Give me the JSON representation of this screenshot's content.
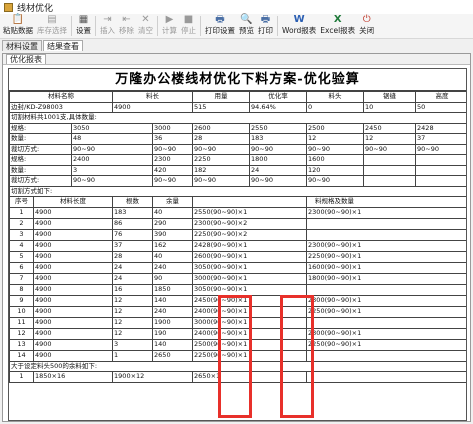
{
  "window": {
    "title": "线材优化"
  },
  "toolbar": [
    {
      "label": "粘贴数据",
      "icon": "paste-icon",
      "enabled": true
    },
    {
      "label": "库存选择",
      "icon": "stock-icon",
      "enabled": false
    },
    {
      "label": "设置",
      "icon": "settings-icon",
      "enabled": true
    },
    {
      "label": "插入",
      "icon": "insert-icon",
      "enabled": false
    },
    {
      "label": "移除",
      "icon": "remove-icon",
      "enabled": false
    },
    {
      "label": "清空",
      "icon": "clear-icon",
      "enabled": false
    },
    {
      "label": "计算",
      "icon": "play-icon",
      "enabled": false
    },
    {
      "label": "停止",
      "icon": "stop-icon",
      "enabled": false
    },
    {
      "label": "打印设置",
      "icon": "print-setup-icon",
      "enabled": true
    },
    {
      "label": "预览",
      "icon": "preview-icon",
      "enabled": true
    },
    {
      "label": "打印",
      "icon": "print-icon",
      "enabled": true
    },
    {
      "label": "Word报表",
      "icon": "word-icon",
      "enabled": true
    },
    {
      "label": "Excel报表",
      "icon": "excel-icon",
      "enabled": true
    },
    {
      "label": "关闭",
      "icon": "close-icon",
      "enabled": true
    }
  ],
  "tabs": [
    "材料设置",
    "结果查看"
  ],
  "subtabs": [
    "优化报表"
  ],
  "report": {
    "title": "万隆办公楼线材优化下料方案-优化验算",
    "material_header": [
      "材料名称",
      "料长",
      "用量",
      "优化率",
      "料头",
      "锯缝",
      "高度"
    ],
    "material_row": [
      "边封/KD-Z98003",
      "4900",
      "515",
      "94.64%",
      "0",
      "10",
      "50"
    ],
    "cut_total_line": "切割材料共1001支,具体数量:",
    "spec_blocks": [
      {
        "spec": [
          "规格:",
          "3050",
          "3000",
          "2600",
          "2550",
          "2500",
          "2450",
          "2428"
        ],
        "qty": [
          "数量:",
          "48",
          "36",
          "28",
          "183",
          "12",
          "12",
          "37"
        ],
        "cut": [
          "裁切方式:",
          "90~90",
          "90~90",
          "90~90",
          "90~90",
          "90~90",
          "90~90",
          "90~90"
        ]
      },
      {
        "spec": [
          "规格:",
          "2400",
          "2300",
          "2250",
          "1800",
          "1600",
          "",
          ""
        ],
        "qty": [
          "数量:",
          "3",
          "420",
          "182",
          "24",
          "120",
          "",
          ""
        ],
        "cut": [
          "裁切方式:",
          "90~90",
          "90~90",
          "90~90",
          "90~90",
          "90~90",
          "",
          ""
        ]
      }
    ],
    "cut_method_line": "切割方式如下:",
    "cut_header": [
      "序号",
      "材料长度",
      "根数",
      "余量",
      "",
      "",
      "料规格及数量"
    ],
    "cut_rows": [
      [
        "1",
        "4900",
        "183",
        "40",
        "2550(90~90)×1",
        "2300(90~90)×1"
      ],
      [
        "2",
        "4900",
        "86",
        "290",
        "2300(90~90)×2",
        ""
      ],
      [
        "3",
        "4900",
        "76",
        "390",
        "2250(90~90)×2",
        ""
      ],
      [
        "4",
        "4900",
        "37",
        "162",
        "2428(90~90)×1",
        "2300(90~90)×1"
      ],
      [
        "5",
        "4900",
        "28",
        "40",
        "2600(90~90)×1",
        "2250(90~90)×1"
      ],
      [
        "6",
        "4900",
        "24",
        "240",
        "3050(90~90)×1",
        "1600(90~90)×1"
      ],
      [
        "7",
        "4900",
        "24",
        "90",
        "3000(90~90)×1",
        "1800(90~90)×1"
      ],
      [
        "8",
        "4900",
        "16",
        "1850",
        "3050(90~90)×1",
        ""
      ],
      [
        "9",
        "4900",
        "12",
        "140",
        "2450(90~90)×1",
        "2300(90~90)×1"
      ],
      [
        "10",
        "4900",
        "12",
        "240",
        "2400(90~90)×1",
        "2250(90~90)×1"
      ],
      [
        "11",
        "4900",
        "12",
        "1900",
        "3000(90~90)×1",
        ""
      ],
      [
        "12",
        "4900",
        "12",
        "190",
        "2400(90~90)×1",
        "2300(90~90)×1"
      ],
      [
        "13",
        "4900",
        "3",
        "140",
        "2500(90~90)×1",
        "2250(90~90)×1"
      ],
      [
        "14",
        "4900",
        "1",
        "2650",
        "2250(90~90)×1",
        ""
      ]
    ],
    "remnant_line": "大于设定料头500的余料如下:",
    "remnants": [
      "1",
      "1850×16",
      "1900×12",
      "2650×1"
    ]
  },
  "accent": "#e8302a"
}
